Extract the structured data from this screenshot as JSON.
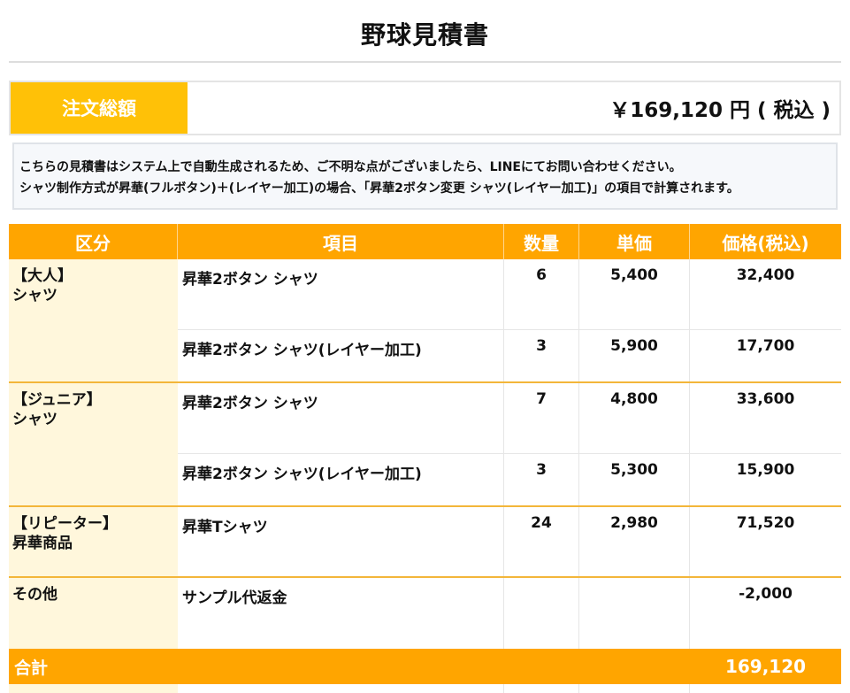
{
  "title": "野球見積書",
  "order_total": {
    "label": "注文総額",
    "value": "￥169,120 円 ( 税込 )"
  },
  "notice": {
    "line1": "こちらの見積書はシステム上で自動生成されるため、ご不明な点がございましたら、LINEにてお問い合わせください。",
    "line2": "シャツ制作方式が昇華(フルボタン)＋(レイヤー加工)の場合、「昇華2ボタン変更 シャツ(レイヤー加工)」の項目で計算されます。"
  },
  "table": {
    "headers": {
      "kubun": "区分",
      "item": "項目",
      "qty": "数量",
      "unit": "単価",
      "price": "価格(税込)"
    },
    "groups": [
      {
        "label_line1": "【大人】",
        "label_line2": "シャツ",
        "rows": [
          {
            "item": "昇華2ボタン シャツ",
            "qty": "6",
            "unit": "5,400",
            "price": "32,400"
          },
          {
            "item": "昇華2ボタン シャツ(レイヤー加工)",
            "qty": "3",
            "unit": "5,900",
            "price": "17,700"
          }
        ]
      },
      {
        "label_line1": "【ジュニア】",
        "label_line2": "シャツ",
        "rows": [
          {
            "item": "昇華2ボタン シャツ",
            "qty": "7",
            "unit": "4,800",
            "price": "33,600"
          },
          {
            "item": "昇華2ボタン シャツ(レイヤー加工)",
            "qty": "3",
            "unit": "5,300",
            "price": "15,900"
          }
        ]
      },
      {
        "label_line1": "【リピーター】",
        "label_line2": "昇華商品",
        "rows": [
          {
            "item": "昇華Tシャツ",
            "qty": "24",
            "unit": "2,980",
            "price": "71,520"
          }
        ]
      },
      {
        "label_line1": "その他",
        "label_line2": "",
        "rows": [
          {
            "item": "サンプル代返金",
            "qty": "",
            "unit": "",
            "price": "-2,000"
          }
        ]
      }
    ],
    "total": {
      "label": "合計",
      "value": "169,120"
    }
  }
}
